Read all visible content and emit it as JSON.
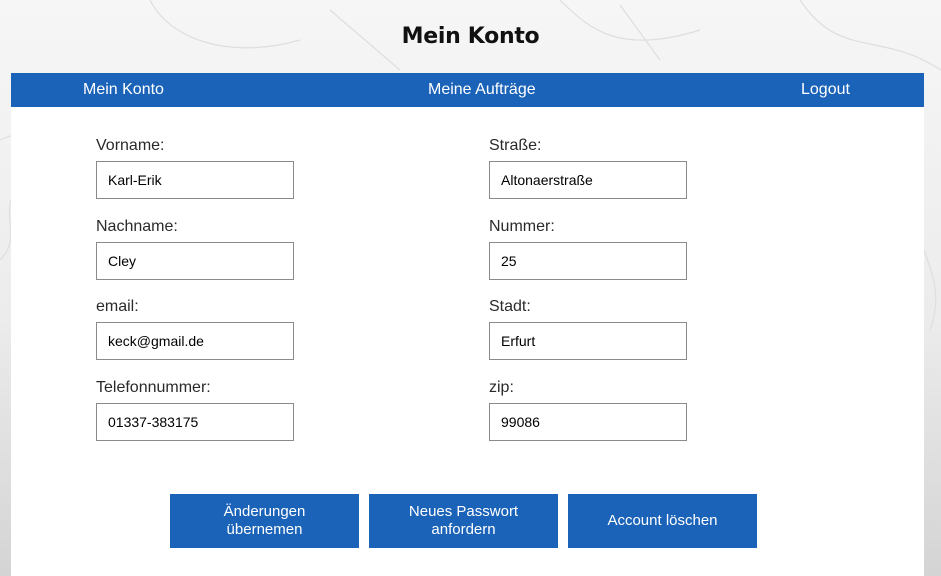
{
  "page": {
    "title": "Mein Konto"
  },
  "nav": {
    "items": [
      {
        "label": "Mein Konto"
      },
      {
        "label": "Meine Aufträge"
      },
      {
        "label": "Logout"
      }
    ]
  },
  "form": {
    "vorname": {
      "label": "Vorname:",
      "value": "Karl-Erik"
    },
    "nachname": {
      "label": "Nachname:",
      "value": "Cley"
    },
    "email": {
      "label": "email:",
      "value": "keck@gmail.de"
    },
    "telefon": {
      "label": "Telefonnummer:",
      "value": "01337-383175"
    },
    "strasse": {
      "label": "Straße:",
      "value": "Altonaerstraße"
    },
    "nummer": {
      "label": "Nummer:",
      "value": "25"
    },
    "stadt": {
      "label": "Stadt:",
      "value": "Erfurt"
    },
    "zip": {
      "label": "zip:",
      "value": "99086"
    }
  },
  "buttons": {
    "save": "Änderungen übernemen",
    "password": "Neues Passwort anfordern",
    "delete": "Account löschen"
  },
  "colors": {
    "primary": "#1a63b8",
    "panel": "#ffffff"
  }
}
